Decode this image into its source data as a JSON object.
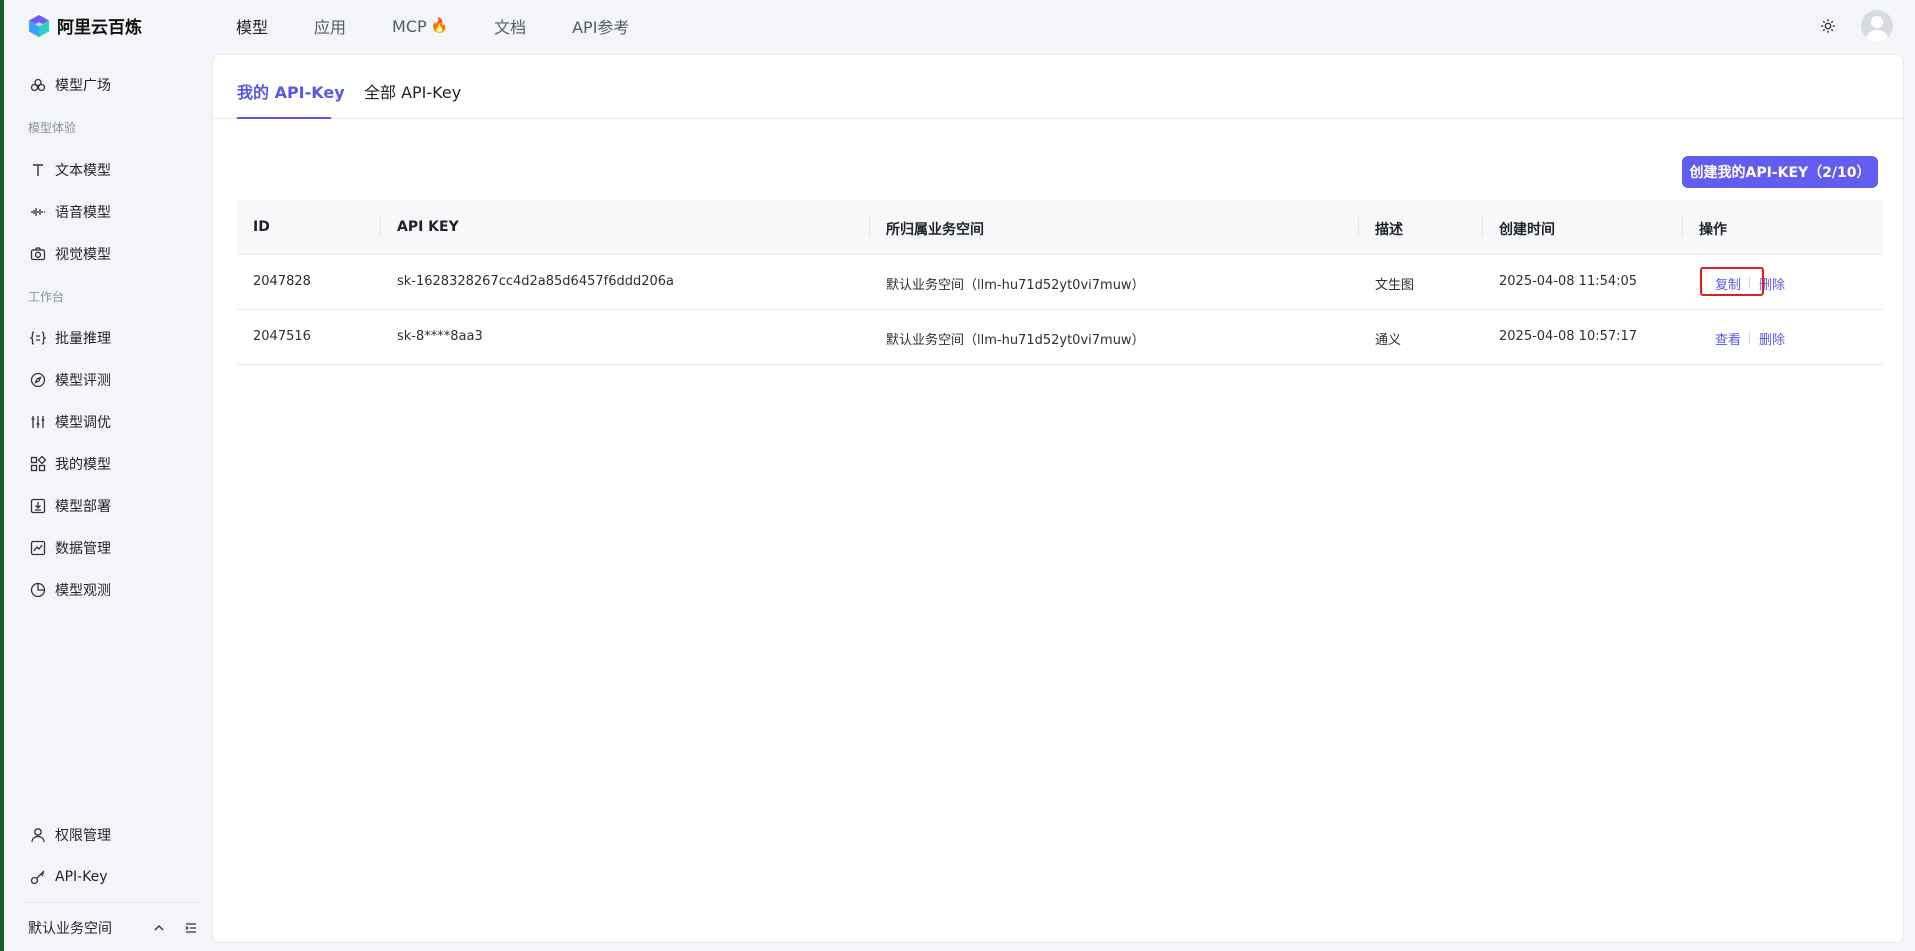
{
  "app": {
    "name": "阿里云百炼"
  },
  "topnav": [
    {
      "label": "模型",
      "active": true
    },
    {
      "label": "应用",
      "active": false
    },
    {
      "label": "MCP",
      "active": false,
      "icon": "flame-icon"
    },
    {
      "label": "文档",
      "active": false
    },
    {
      "label": "API参考",
      "active": false
    }
  ],
  "sidebar": {
    "model_plaza": "模型广场",
    "group_experience": "模型体验",
    "text_model": "文本模型",
    "voice_model": "语音模型",
    "vision_model": "视觉模型",
    "group_workbench": "工作台",
    "batch_inference": "批量推理",
    "model_eval": "模型评测",
    "model_tuning": "模型调优",
    "my_models": "我的模型",
    "model_deploy": "模型部署",
    "data_mgmt": "数据管理",
    "model_observe": "模型观测",
    "permissions": "权限管理",
    "api_key": "API-Key",
    "workspace": "默认业务空间"
  },
  "tabs": {
    "my_key": "我的 API-Key",
    "all_keys": "全部 API-Key"
  },
  "create_button": "创建我的API-KEY（2/10）",
  "table": {
    "columns": {
      "id": "ID",
      "api_key": "API KEY",
      "workspace": "所归属业务空间",
      "desc": "描述",
      "created": "创建时间",
      "actions": "操作"
    },
    "rows": [
      {
        "id": "2047828",
        "api_key": "sk-1628328267cc4d2a85d6457f6ddd206a",
        "workspace": "默认业务空间（llm-hu71d52yt0vi7muw）",
        "desc": "文生图",
        "created": "2025-04-08 11:54:05",
        "action_primary": "复制",
        "action_delete": "删除"
      },
      {
        "id": "2047516",
        "api_key": "sk-8****8aa3",
        "workspace": "默认业务空间（llm-hu71d52yt0vi7muw）",
        "desc": "通义",
        "created": "2025-04-08 10:57:17",
        "action_primary": "查看",
        "action_delete": "删除"
      }
    ]
  },
  "colors": {
    "accent": "#5b57e6",
    "button": "#625cf0",
    "highlight": "#e02020"
  }
}
